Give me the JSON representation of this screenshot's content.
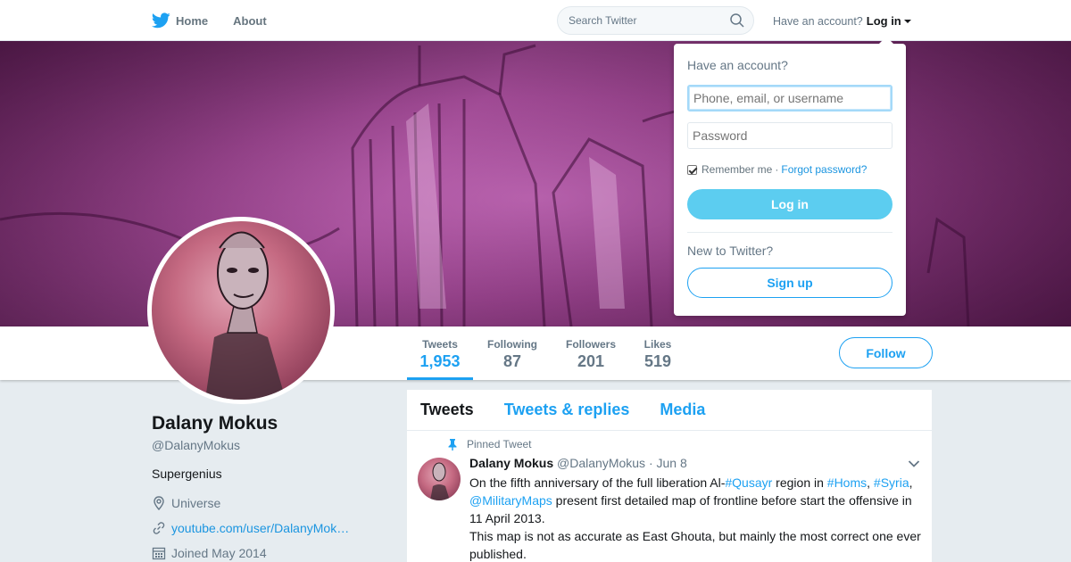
{
  "nav": {
    "home_label": "Home",
    "about_label": "About",
    "search_placeholder": "Search Twitter",
    "have_account": "Have an account?",
    "login_label": "Log in"
  },
  "profile": {
    "name": "Dalany Mokus",
    "handle": "@DalanyMokus",
    "bio": "Supergenius",
    "location": "Universe",
    "website": "youtube.com/user/DalanyMok…",
    "joined": "Joined May 2014"
  },
  "stats": [
    {
      "label": "Tweets",
      "value": "1,953"
    },
    {
      "label": "Following",
      "value": "87"
    },
    {
      "label": "Followers",
      "value": "201"
    },
    {
      "label": "Likes",
      "value": "519"
    }
  ],
  "follow_label": "Follow",
  "tabs": [
    "Tweets",
    "Tweets & replies",
    "Media"
  ],
  "tweet": {
    "pinned_label": "Pinned Tweet",
    "author_name": "Dalany Mokus",
    "author_handle": "@DalanyMokus",
    "date": "· Jun 8",
    "text_1": "On the fifth anniversary of the full liberation Al-",
    "tag_qusayr": "#Qusayr",
    "text_2": " region in ",
    "tag_homs": "#Homs",
    "text_3": ", ",
    "tag_syria": "#Syria",
    "text_4": ",",
    "mention": "@MilitaryMaps",
    "text_5": " present first detailed map of frontline before start the offensive in 11 April 2013.",
    "text_6": "This map is not as accurate as East Ghouta, but mainly the most correct one ever published."
  },
  "login_dropdown": {
    "title": "Have an account?",
    "username_placeholder": "Phone, email, or username",
    "password_placeholder": "Password",
    "remember_label": "Remember me",
    "separator": "·",
    "forgot_label": "Forgot password?",
    "login_button": "Log in",
    "new_to": "New to Twitter?",
    "signup_button": "Sign up"
  },
  "colors": {
    "accent": "#1da1f2",
    "login_button_bg": "#5ccdf0"
  }
}
